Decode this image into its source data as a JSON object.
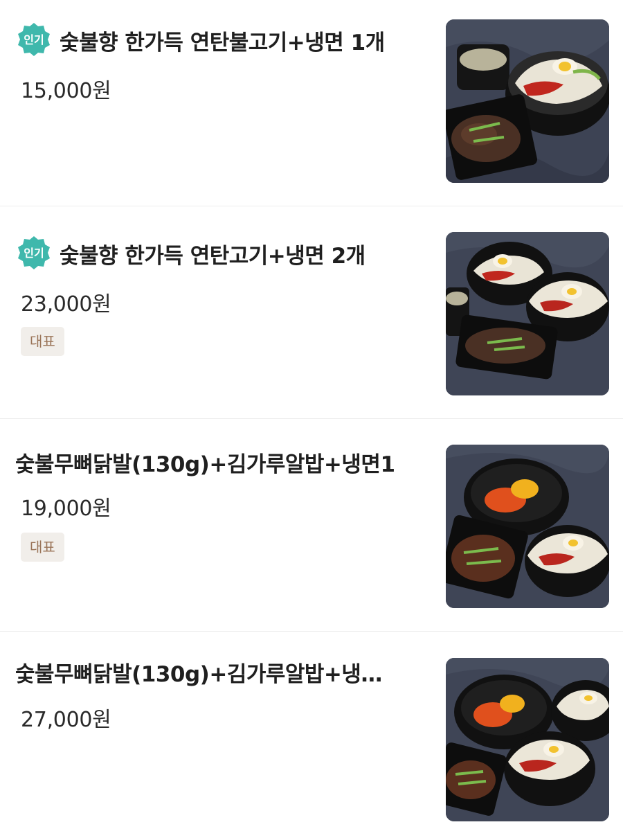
{
  "menu_items": [
    {
      "name": "숯불향 한가득 연탄불고기+냉면 1개",
      "price": "15,000원",
      "badge": "인기",
      "tag": "",
      "image": "bulgogi-naengmyeon-set-photo"
    },
    {
      "name": "숯불향 한가득 연탄고기+냉면 2개",
      "price": "23,000원",
      "badge": "인기",
      "tag": "대표",
      "image": "bulgogi-naengmyeon-double-set-photo"
    },
    {
      "name": "숯불무뼈닭발(130g)+김가루알밥+냉면1",
      "price": "19,000원",
      "badge": "",
      "tag": "대표",
      "image": "chicken-feet-albap-naengmyeon-set-photo"
    },
    {
      "name": "숯불무뼈닭발(130g)+김가루알밥+냉…",
      "price": "27,000원",
      "badge": "",
      "tag": "",
      "image": "chicken-feet-albap-naengmyeon-large-set-photo"
    }
  ],
  "colors": {
    "popular_badge": "#3fb8ac",
    "tag_bg": "#f1eeea",
    "tag_text": "#9a7458",
    "divider": "#ececec"
  }
}
